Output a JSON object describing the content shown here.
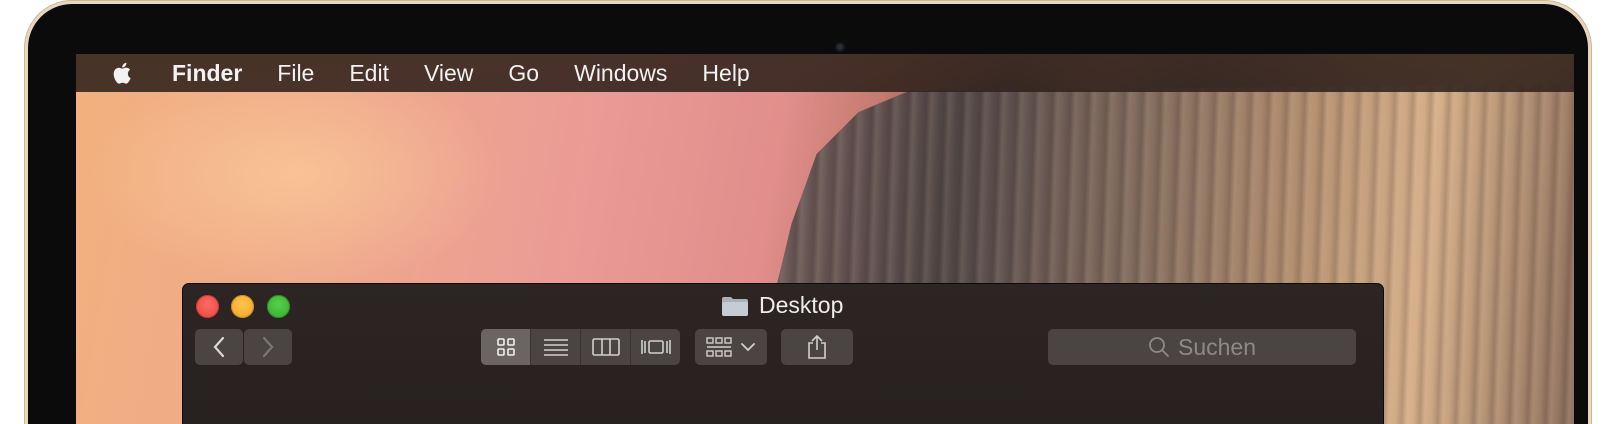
{
  "menubar": {
    "apple_icon": "apple-logo",
    "app_name": "Finder",
    "items": [
      "File",
      "Edit",
      "View",
      "Go",
      "Windows",
      "Help"
    ]
  },
  "window": {
    "title": "Desktop",
    "title_icon": "folder-icon",
    "toolbar": {
      "nav": [
        "back",
        "forward"
      ],
      "view_modes": [
        "icon",
        "list",
        "column",
        "cover-flow"
      ],
      "active_view": "icon",
      "arrange_icon": "arrange-grid-icon",
      "share_icon": "share-icon",
      "search_placeholder": "Suchen"
    }
  },
  "colors": {
    "close": "#ff5f57",
    "minimize": "#febc2e",
    "zoom": "#28c840"
  }
}
